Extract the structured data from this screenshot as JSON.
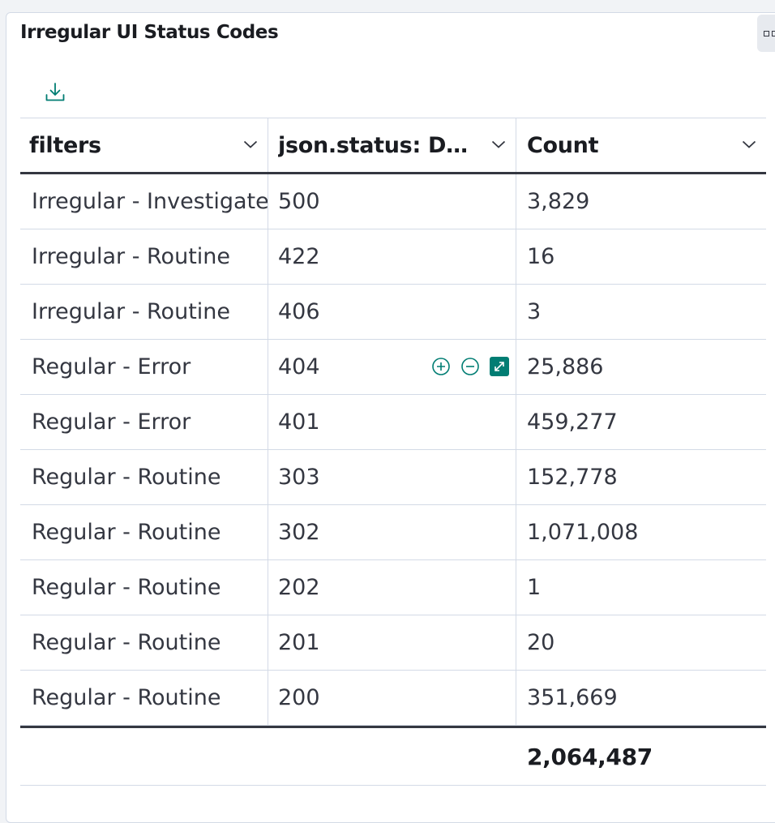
{
  "panel": {
    "title": "Irregular UI Status Codes",
    "accent_color": "#017d73"
  },
  "toolbar": {
    "download_icon": "download-icon"
  },
  "table": {
    "columns": [
      {
        "label": "filters"
      },
      {
        "label": "json.status: Des..."
      },
      {
        "label": "Count"
      }
    ],
    "rows": [
      {
        "filter": "Irregular - Investigate",
        "status": "500",
        "count": "3,829"
      },
      {
        "filter": "Irregular - Routine",
        "status": "422",
        "count": "16"
      },
      {
        "filter": "Irregular - Routine",
        "status": "406",
        "count": "3"
      },
      {
        "filter": "Regular - Error",
        "status": "404",
        "count": "25,886"
      },
      {
        "filter": "Regular - Error",
        "status": "401",
        "count": "459,277"
      },
      {
        "filter": "Regular - Routine",
        "status": "303",
        "count": "152,778"
      },
      {
        "filter": "Regular - Routine",
        "status": "302",
        "count": "1,071,008"
      },
      {
        "filter": "Regular - Routine",
        "status": "202",
        "count": "1"
      },
      {
        "filter": "Regular - Routine",
        "status": "201",
        "count": "20"
      },
      {
        "filter": "Regular - Routine",
        "status": "200",
        "count": "351,669"
      }
    ],
    "hovered_cell_actions": [
      "plus-circle-icon",
      "minus-circle-icon",
      "expand-icon"
    ],
    "total": "2,064,487"
  }
}
